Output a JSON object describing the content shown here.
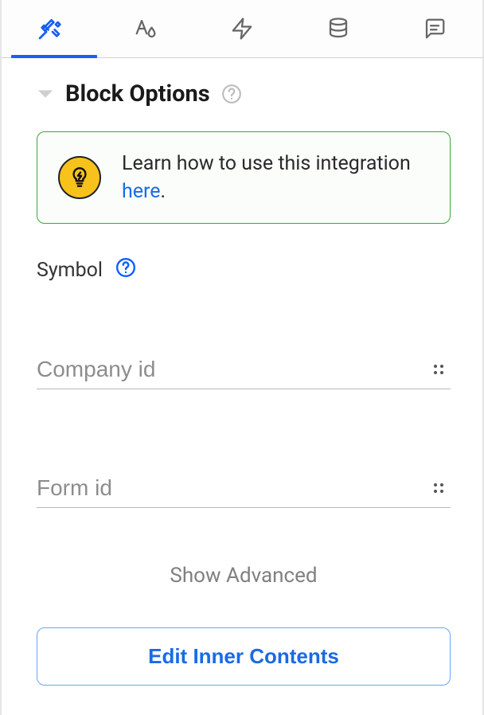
{
  "tabs": {
    "active_index": 0,
    "items": [
      {
        "name": "design-tab",
        "icon": "tools-icon"
      },
      {
        "name": "style-tab",
        "icon": "text-drop-icon"
      },
      {
        "name": "actions-tab",
        "icon": "bolt-icon"
      },
      {
        "name": "data-tab",
        "icon": "database-icon"
      },
      {
        "name": "comments-tab",
        "icon": "chat-icon"
      }
    ]
  },
  "section": {
    "title": "Block Options"
  },
  "banner": {
    "text_prefix": "Learn how to use this integration ",
    "link_text": "here",
    "text_suffix": "."
  },
  "symbol": {
    "label": "Symbol"
  },
  "fields": {
    "company_id": {
      "placeholder": "Company id",
      "value": ""
    },
    "form_id": {
      "placeholder": "Form id",
      "value": ""
    }
  },
  "show_advanced": "Show Advanced",
  "edit_button": "Edit Inner Contents"
}
